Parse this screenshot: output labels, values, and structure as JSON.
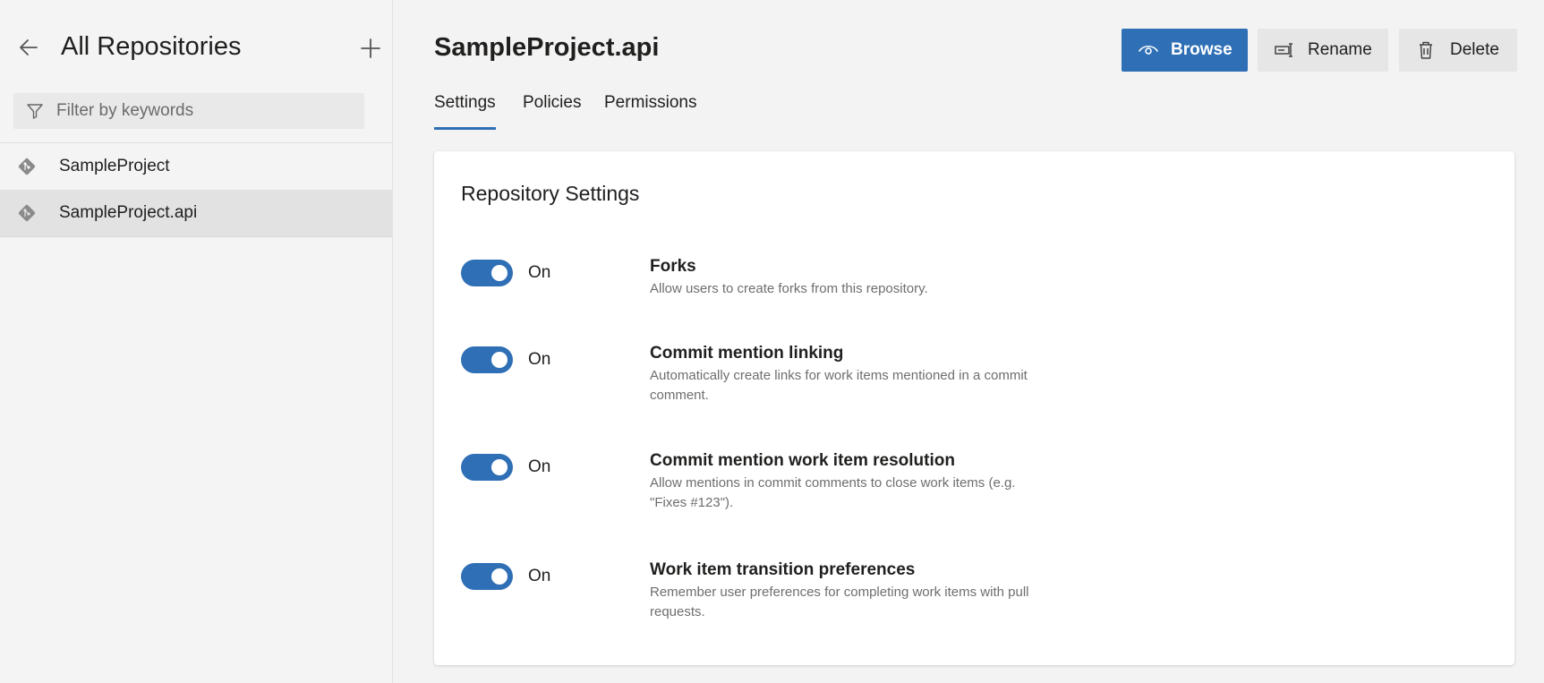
{
  "sidebar": {
    "title": "All Repositories",
    "back_icon": "arrow-left-icon",
    "add_icon": "plus-icon",
    "filter": {
      "placeholder": "Filter by keywords",
      "value": "",
      "icon": "filter-icon"
    },
    "repos": [
      {
        "label": "SampleProject",
        "icon": "git-repo-icon",
        "selected": false
      },
      {
        "label": "SampleProject.api",
        "icon": "git-repo-icon",
        "selected": true
      }
    ]
  },
  "header": {
    "title": "SampleProject.api",
    "actions": {
      "browse": {
        "label": "Browse",
        "icon": "eye-icon"
      },
      "rename": {
        "label": "Rename",
        "icon": "rename-icon"
      },
      "delete": {
        "label": "Delete",
        "icon": "trash-icon"
      }
    }
  },
  "tabs": [
    {
      "label": "Settings",
      "active": true
    },
    {
      "label": "Policies",
      "active": false
    },
    {
      "label": "Permissions",
      "active": false
    }
  ],
  "card": {
    "title": "Repository Settings",
    "settings": [
      {
        "state_label": "On",
        "enabled": true,
        "title": "Forks",
        "description": "Allow users to create forks from this repository."
      },
      {
        "state_label": "On",
        "enabled": true,
        "title": "Commit mention linking",
        "description": "Automatically create links for work items mentioned in a commit comment."
      },
      {
        "state_label": "On",
        "enabled": true,
        "title": "Commit mention work item resolution",
        "description": "Allow mentions in commit comments to close work items (e.g. \"Fixes #123\")."
      },
      {
        "state_label": "On",
        "enabled": true,
        "title": "Work item transition preferences",
        "description": "Remember user preferences for completing work items with pull requests."
      }
    ]
  },
  "colors": {
    "accent": "#2f6fb5",
    "sidebar_bg": "#f4f4f4",
    "page_bg": "#f3f3f3",
    "card_bg": "#ffffff",
    "secondary_button_bg": "#e6e6e6"
  }
}
